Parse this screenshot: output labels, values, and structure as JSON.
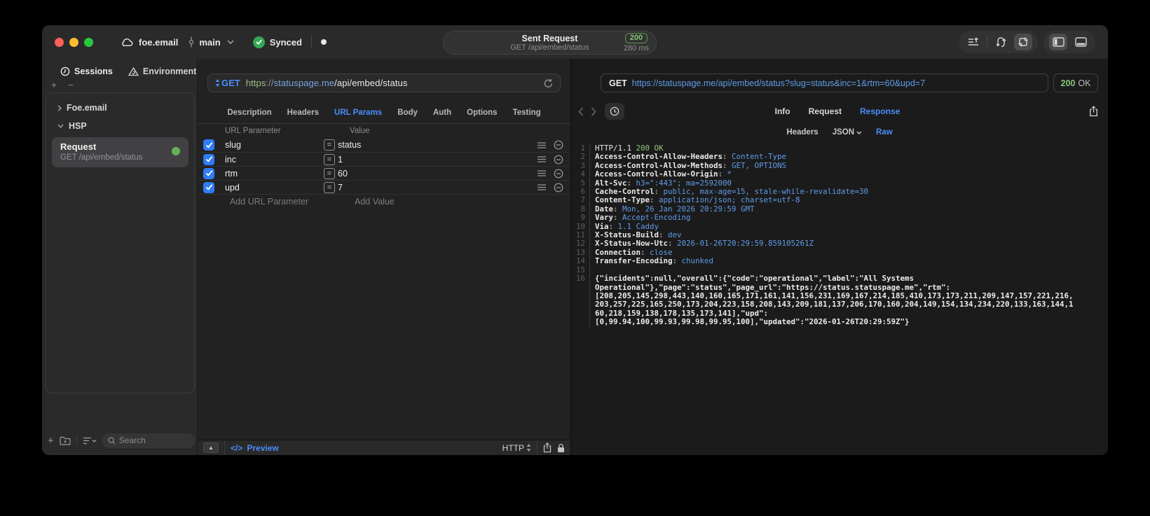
{
  "titlebar": {
    "project": "foe.email",
    "branch": "main",
    "sync_label": "Synced",
    "request_title": "Sent Request",
    "request_subtitle": "GET /api/embed/status",
    "status_code": "200",
    "duration": "280 ms"
  },
  "sidebar": {
    "tabs": [
      {
        "label": "Sessions",
        "icon": "clock-icon"
      },
      {
        "label": "Environments",
        "icon": "prism-icon"
      }
    ],
    "groups": [
      {
        "label": "Foe.email",
        "expanded": false
      },
      {
        "label": "HSP",
        "expanded": true
      }
    ],
    "request_item": {
      "title": "Request",
      "subtitle": "GET /api/embed/status"
    },
    "search_placeholder": "Search"
  },
  "request_panel": {
    "method": "GET",
    "url": {
      "scheme": "https",
      "separator": "://",
      "host": "statuspage.me",
      "path": "/api/embed/status"
    },
    "tabs": [
      "Description",
      "Headers",
      "URL Params",
      "Body",
      "Auth",
      "Options",
      "Testing"
    ],
    "active_tab": "URL Params",
    "params": {
      "col_name": "URL Parameter",
      "col_value": "Value",
      "rows": [
        {
          "name": "slug",
          "value": "status",
          "checked": true
        },
        {
          "name": "inc",
          "value": "1",
          "checked": true
        },
        {
          "name": "rtm",
          "value": "60",
          "checked": true
        },
        {
          "name": "upd",
          "value": "7",
          "checked": true
        }
      ],
      "add_name": "Add URL Parameter",
      "add_value": "Add Value"
    },
    "footer": {
      "preview": "Preview",
      "code_glyph": "</>",
      "protocol": "HTTP"
    }
  },
  "response_panel": {
    "method": "GET",
    "url": "https://statuspage.me/api/embed/status?slug=status&inc=1&rtm=60&upd=7",
    "status_code": "200",
    "status_text": "OK",
    "tabs": [
      "Info",
      "Request",
      "Response"
    ],
    "active_tab": "Response",
    "subtabs": [
      "Headers",
      "JSON",
      "Raw"
    ],
    "active_subtab": "Raw",
    "raw": {
      "status_line": {
        "protocol": "HTTP/1.1 ",
        "status": "200 OK"
      },
      "headers": [
        {
          "name": "Access-Control-Allow-Headers",
          "value": "Content-Type"
        },
        {
          "name": "Access-Control-Allow-Methods",
          "value": "GET, OPTIONS"
        },
        {
          "name": "Access-Control-Allow-Origin",
          "value": "*"
        },
        {
          "name": "Alt-Svc",
          "value": "h3=\":443\"; ma=2592000"
        },
        {
          "name": "Cache-Control",
          "value": "public, max-age=15, stale-while-revalidate=30"
        },
        {
          "name": "Content-Type",
          "value": "application/json; charset=utf-8"
        },
        {
          "name": "Date",
          "value": "Mon, 26 Jan 2026 20:29:59 GMT"
        },
        {
          "name": "Vary",
          "value": "Accept-Encoding"
        },
        {
          "name": "Via",
          "value": "1.1 Caddy"
        },
        {
          "name": "X-Status-Build",
          "value": "dev"
        },
        {
          "name": "X-Status-Now-Utc",
          "value": "2026-01-26T20:29:59.859105261Z"
        },
        {
          "name": "Connection",
          "value": "close"
        },
        {
          "name": "Transfer-Encoding",
          "value": "chunked"
        }
      ],
      "body_lines": [
        "{\"incidents\":null,\"overall\":{\"code\":\"operational\",\"label\":\"All Systems",
        "Operational\"},\"page\":\"status\",\"page_url\":\"https://status.statuspage.me\",\"rtm\":",
        "[208,205,145,298,443,140,160,165,171,161,141,156,231,169,167,214,185,410,173,173,211,209,147,157,221,216,",
        "203,257,225,165,250,173,204,223,158,208,143,209,181,137,206,170,160,204,149,154,134,234,220,133,163,144,1",
        "60,218,159,138,178,135,173,141],\"upd\":",
        "[0,99.94,100,99.93,99.98,99.95,100],\"updated\":\"2026-01-26T20:29:59Z\"}"
      ]
    }
  }
}
